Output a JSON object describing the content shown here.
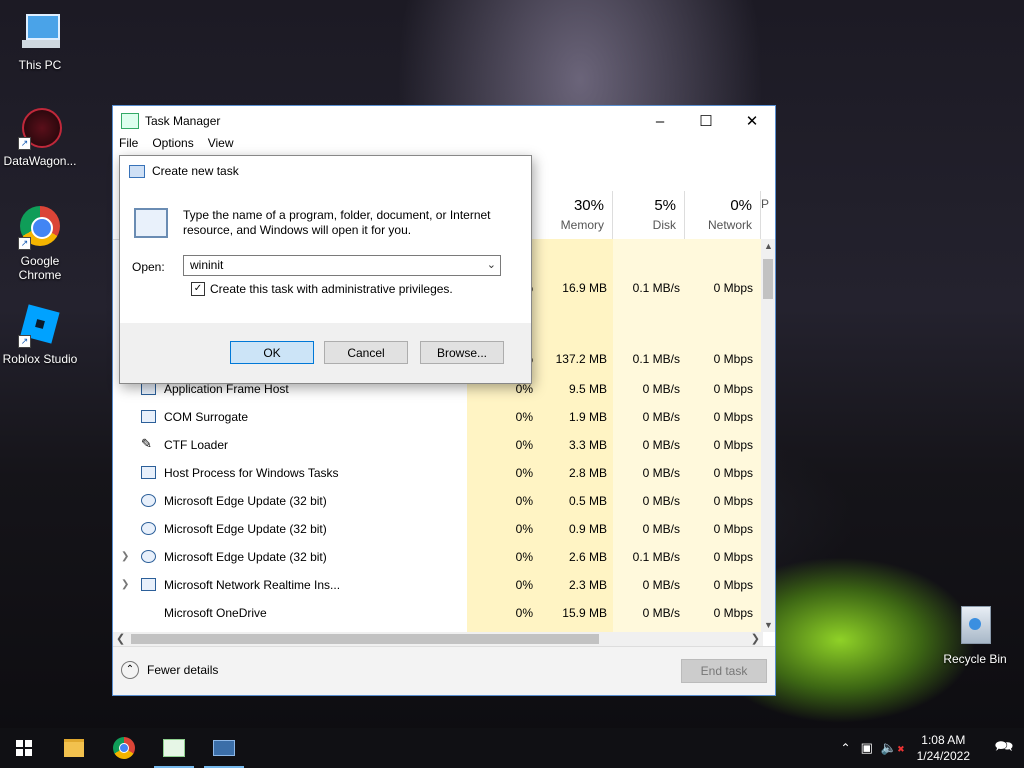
{
  "desktop": {
    "icons": [
      {
        "label": "This PC",
        "icon": "computer-icon"
      },
      {
        "label": "DataWagon...",
        "icon": "datawagon-icon"
      },
      {
        "label": "Google Chrome",
        "icon": "chrome-icon"
      },
      {
        "label": "Roblox Studio",
        "icon": "roblox-studio-icon"
      },
      {
        "label": "Recycle Bin",
        "icon": "recycle-bin-icon"
      }
    ]
  },
  "task_manager": {
    "title": "Task Manager",
    "menu": [
      "File",
      "Options",
      "View"
    ],
    "columns": [
      {
        "pct": "30%",
        "name": "Memory"
      },
      {
        "pct": "5%",
        "name": "Disk"
      },
      {
        "pct": "0%",
        "name": "Network"
      },
      {
        "pct": "",
        "name": "P"
      }
    ],
    "rows": [
      {
        "name": "",
        "cpu": "",
        "mem": "",
        "disk": "",
        "net": ""
      },
      {
        "name": "",
        "cpu": "%",
        "mem": "16.9 MB",
        "disk": "0.1 MB/s",
        "net": "0 Mbps"
      },
      {
        "name": "",
        "cpu": "",
        "mem": "",
        "disk": "",
        "net": ""
      },
      {
        "name": "",
        "cpu": "%",
        "mem": "137.2 MB",
        "disk": "0.1 MB/s",
        "net": "0 Mbps"
      },
      {
        "name": "Application Frame Host",
        "cpu": "0%",
        "mem": "9.5 MB",
        "disk": "0 MB/s",
        "net": "0 Mbps"
      },
      {
        "name": "COM Surrogate",
        "cpu": "0%",
        "mem": "1.9 MB",
        "disk": "0 MB/s",
        "net": "0 Mbps"
      },
      {
        "name": "CTF Loader",
        "cpu": "0%",
        "mem": "3.3 MB",
        "disk": "0 MB/s",
        "net": "0 Mbps"
      },
      {
        "name": "Host Process for Windows Tasks",
        "cpu": "0%",
        "mem": "2.8 MB",
        "disk": "0 MB/s",
        "net": "0 Mbps"
      },
      {
        "name": "Microsoft Edge Update (32 bit)",
        "cpu": "0%",
        "mem": "0.5 MB",
        "disk": "0 MB/s",
        "net": "0 Mbps"
      },
      {
        "name": "Microsoft Edge Update (32 bit)",
        "cpu": "0%",
        "mem": "0.9 MB",
        "disk": "0 MB/s",
        "net": "0 Mbps"
      },
      {
        "name": "Microsoft Edge Update (32 bit)",
        "cpu": "0%",
        "mem": "2.6 MB",
        "disk": "0.1 MB/s",
        "net": "0 Mbps"
      },
      {
        "name": "Microsoft Network Realtime Ins...",
        "cpu": "0%",
        "mem": "2.3 MB",
        "disk": "0 MB/s",
        "net": "0 Mbps"
      },
      {
        "name": "Microsoft OneDrive",
        "cpu": "0%",
        "mem": "15.9 MB",
        "disk": "0 MB/s",
        "net": "0 Mbps"
      }
    ],
    "fewer_details": "Fewer details",
    "end_task": "End task"
  },
  "dialog": {
    "title": "Create new task",
    "message": "Type the name of a program, folder, document, or Internet resource, and Windows will open it for you.",
    "open_label": "Open:",
    "open_value": "wininit",
    "admin_checkbox": "Create this task with administrative privileges.",
    "ok": "OK",
    "cancel": "Cancel",
    "browse": "Browse..."
  },
  "taskbar": {
    "time": "1:08 AM",
    "date": "1/24/2022"
  }
}
